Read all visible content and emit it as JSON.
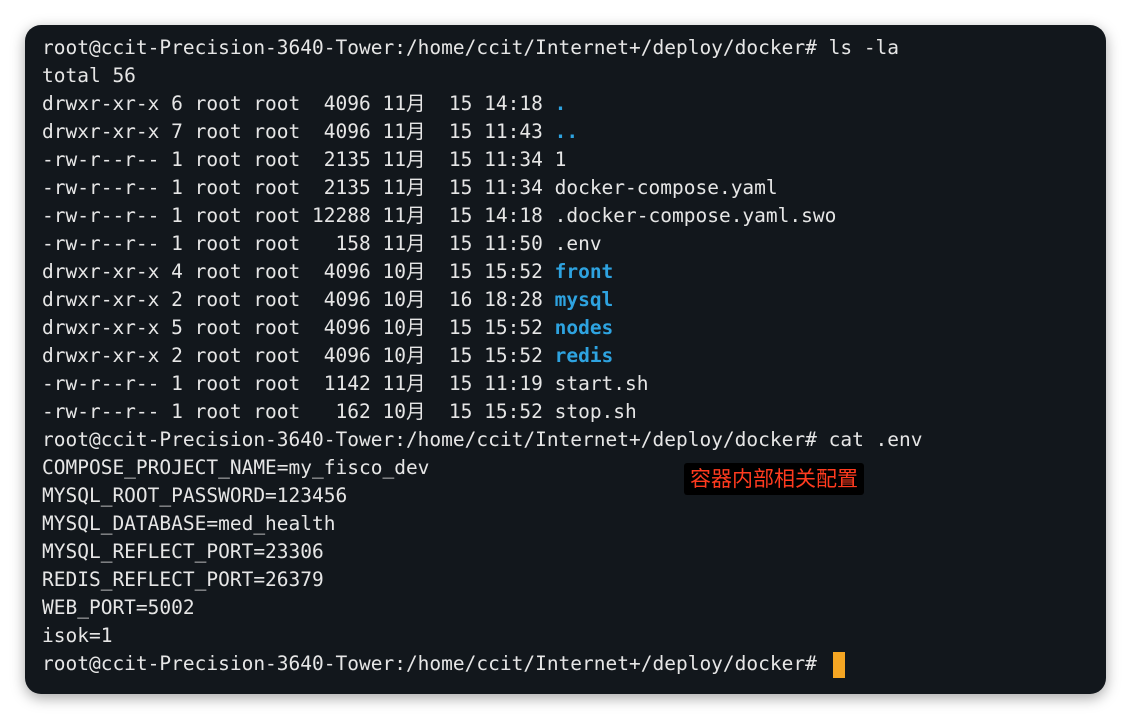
{
  "terminal": {
    "prompt": "root@ccit-Precision-3640-Tower:/home/ccit/Internet+/deploy/docker# ",
    "command1": "ls -la",
    "total": "total 56",
    "entries": [
      {
        "info": "drwxr-xr-x 6 root root  4096 11月  15 14:18 ",
        "name": ".",
        "dir": true
      },
      {
        "info": "drwxr-xr-x 7 root root  4096 11月  15 11:43 ",
        "name": "..",
        "dir": true
      },
      {
        "info": "-rw-r--r-- 1 root root  2135 11月  15 11:34 ",
        "name": "1",
        "dir": false
      },
      {
        "info": "-rw-r--r-- 1 root root  2135 11月  15 11:34 ",
        "name": "docker-compose.yaml",
        "dir": false
      },
      {
        "info": "-rw-r--r-- 1 root root 12288 11月  15 14:18 ",
        "name": ".docker-compose.yaml.swo",
        "dir": false
      },
      {
        "info": "-rw-r--r-- 1 root root   158 11月  15 11:50 ",
        "name": ".env",
        "dir": false
      },
      {
        "info": "drwxr-xr-x 4 root root  4096 10月  15 15:52 ",
        "name": "front",
        "dir": true
      },
      {
        "info": "drwxr-xr-x 2 root root  4096 10月  16 18:28 ",
        "name": "mysql",
        "dir": true
      },
      {
        "info": "drwxr-xr-x 5 root root  4096 10月  15 15:52 ",
        "name": "nodes",
        "dir": true
      },
      {
        "info": "drwxr-xr-x 2 root root  4096 10月  15 15:52 ",
        "name": "redis",
        "dir": true
      },
      {
        "info": "-rw-r--r-- 1 root root  1142 11月  15 11:19 ",
        "name": "start.sh",
        "dir": false
      },
      {
        "info": "-rw-r--r-- 1 root root   162 10月  15 15:52 ",
        "name": "stop.sh",
        "dir": false
      }
    ],
    "command2": "cat .env",
    "env_lines": [
      "COMPOSE_PROJECT_NAME=my_fisco_dev",
      "MYSQL_ROOT_PASSWORD=123456",
      "MYSQL_DATABASE=med_health",
      "MYSQL_REFLECT_PORT=23306",
      "REDIS_REFLECT_PORT=26379",
      "WEB_PORT=5002",
      "isok=1"
    ]
  },
  "annotation": "容器内部相关配置",
  "colors": {
    "background": "#12171c",
    "text": "#e6e6e6",
    "directory": "#2ea3e0",
    "cursor": "#f5a623",
    "annotation_text": "#ff3b1f"
  }
}
